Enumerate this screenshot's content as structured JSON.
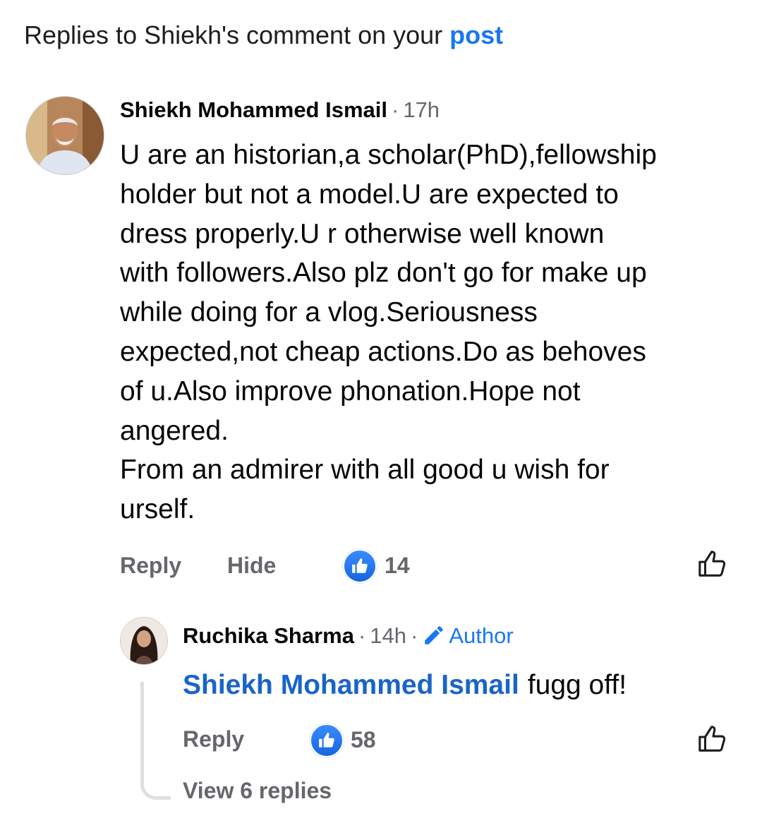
{
  "header": {
    "prefix": "Replies to Shiekh's comment on your",
    "link": "post"
  },
  "comment": {
    "author": "Shiekh Mohammed Ismail",
    "time": "17h",
    "text": "U are an historian,a scholar(PhD),fellowship\nholder but not a model.U are expected to\ndress properly.U r otherwise well known\nwith followers.Also plz don't go for make up\nwhile doing for a vlog.Seriousness\nexpected,not cheap actions.Do as behoves\nof u.Also improve phonation.Hope not\nangered.\nFrom an admirer with all good u wish for\nurself.",
    "actions": {
      "reply": "Reply",
      "hide": "Hide"
    },
    "like_count": "14"
  },
  "reply": {
    "author": "Ruchika Sharma",
    "time": "14h",
    "badge": "Author",
    "mention": "Shiekh Mohammed Ismail",
    "text": "fugg off!",
    "actions": {
      "reply": "Reply"
    },
    "like_count": "58",
    "view_replies": "View 6 replies"
  },
  "icons": {
    "like_badge": "thumbs-up-filled-icon",
    "like_button": "thumbs-up-outline-icon",
    "author_badge": "pencil-icon"
  },
  "colors": {
    "accent": "#1877f2",
    "secondary_text": "#65676b"
  }
}
